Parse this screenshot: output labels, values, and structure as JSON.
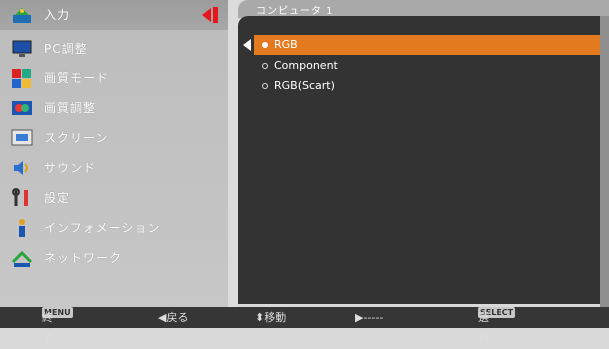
{
  "menu": [
    {
      "label": "入力",
      "icon": "input-icon"
    },
    {
      "label": "PC調整",
      "icon": "pc-adjust-icon"
    },
    {
      "label": "画質モード",
      "icon": "image-mode-icon"
    },
    {
      "label": "画質調整",
      "icon": "image-adjust-icon"
    },
    {
      "label": "スクリーン",
      "icon": "screen-icon"
    },
    {
      "label": "サウンド",
      "icon": "sound-icon"
    },
    {
      "label": "設定",
      "icon": "settings-icon"
    },
    {
      "label": "インフォメーション",
      "icon": "information-icon"
    },
    {
      "label": "ネットワーク",
      "icon": "network-icon"
    }
  ],
  "submenu": {
    "title": "コンピュータ 1",
    "options": [
      "RGB",
      "Component",
      "RGB(Scart)"
    ],
    "selected_index": 0
  },
  "footer": {
    "menu_key": "MENU",
    "menu_label": "終了",
    "back_label": "◀戻る",
    "move_label": "⬍移動",
    "next_label": "▶-----",
    "select_key": "SELECT",
    "select_label": "選択"
  },
  "colors": {
    "accent": "#e8151c",
    "highlight": "#e37a20",
    "panel": "#333333"
  }
}
